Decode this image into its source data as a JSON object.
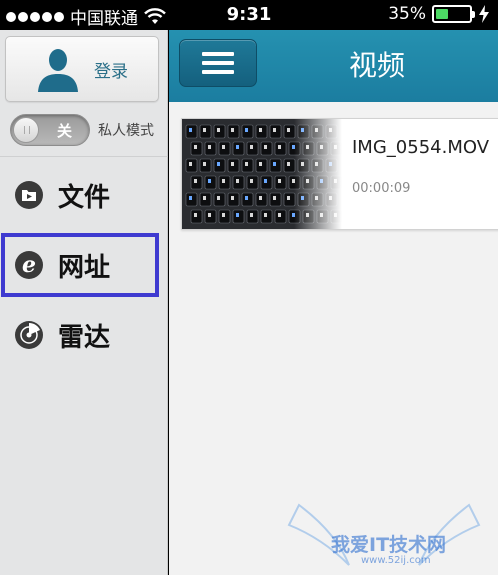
{
  "status_bar": {
    "carrier": "中国联通",
    "time": "9:31",
    "battery_percent": "35%",
    "battery_level": 0.35,
    "signal_dots": 5
  },
  "sidebar": {
    "login_label": "登录",
    "private_mode": {
      "toggle_label": "关",
      "label": "私人模式",
      "enabled": false
    },
    "items": [
      {
        "label": "文件",
        "icon": "folder-icon"
      },
      {
        "label": "网址",
        "icon": "ie-browser-icon"
      },
      {
        "label": "雷达",
        "icon": "radar-icon"
      }
    ]
  },
  "main": {
    "title": "视频",
    "videos": [
      {
        "name": "IMG_0554.MOV",
        "duration": "00:00:09"
      }
    ]
  },
  "watermark": {
    "text": "我爱IT技术网",
    "url": "www.52ij.com"
  },
  "colors": {
    "header_blue": "#1b7da0",
    "highlight_border": "#3e3ad0",
    "battery_green": "#4cd964"
  }
}
